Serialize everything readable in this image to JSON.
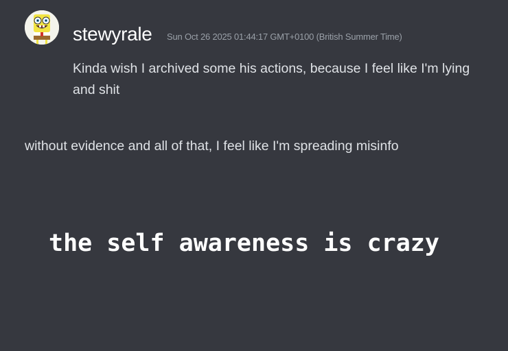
{
  "message": {
    "author": {
      "username": "stewyrale",
      "avatar_icon": "spongebob-avatar-icon"
    },
    "timestamp": "Sun Oct 26 2025 01:44:17 GMT+0100 (British Summer Time)",
    "lines": [
      "Kinda wish I archived some his actions, because I feel like I'm lying and shit",
      "without evidence and all of that, I feel like I'm spreading misinfo"
    ]
  },
  "caption": "the self awareness is crazy",
  "colors": {
    "background": "#36383f",
    "username": "#ffffff",
    "timestamp": "#9aa0a8",
    "message_text": "#dfe2e6",
    "caption_text": "#ffffff"
  }
}
